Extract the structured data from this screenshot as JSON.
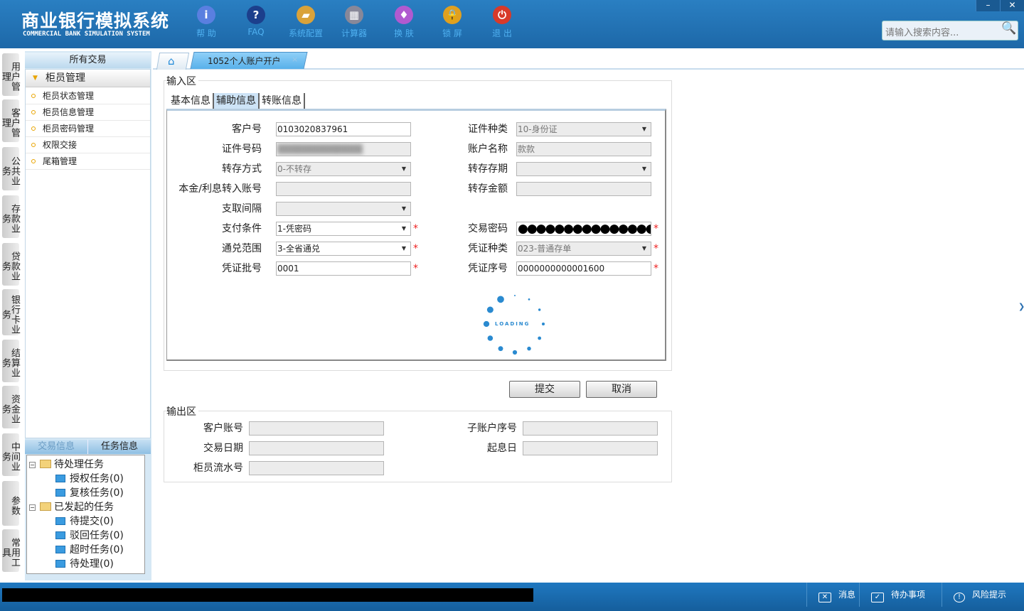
{
  "header": {
    "title_cn": "商业银行模拟系统",
    "title_en": "COMMERCIAL BANK SIMULATION SYSTEM",
    "tools": [
      {
        "label": "帮 助",
        "icon": "info-icon"
      },
      {
        "label": "FAQ",
        "icon": "question-icon"
      },
      {
        "label": "系统配置",
        "icon": "toolbox-icon"
      },
      {
        "label": "计算器",
        "icon": "calculator-icon"
      },
      {
        "label": "换 肤",
        "icon": "shirt-icon"
      },
      {
        "label": "锁 屏",
        "icon": "lock-icon"
      },
      {
        "label": "退 出",
        "icon": "power-icon"
      }
    ],
    "search_placeholder": "请输入搜索内容...",
    "minimize": "–",
    "close": "✕"
  },
  "vtabs": [
    "用户管理",
    "客户管理",
    "公共业务",
    "存款业务",
    "贷款业务",
    "银行卡业务",
    "结算业务",
    "资金业务",
    "中间业务",
    "参数",
    "常用工具"
  ],
  "menu": {
    "header": "所有交易",
    "group": "柜员管理",
    "items": [
      "柜员状态管理",
      "柜员信息管理",
      "柜员密码管理",
      "权限交接",
      "尾箱管理"
    ]
  },
  "tasks": {
    "tabs": [
      "交易信息",
      "任务信息"
    ],
    "active_tab": "任务信息",
    "tree": [
      {
        "label": "待处理任务",
        "children": [
          "授权任务(0)",
          "复核任务(0)"
        ]
      },
      {
        "label": "已发起的任务",
        "children": [
          "待提交(0)",
          "驳回任务(0)",
          "超时任务(0)",
          "待处理(0)"
        ]
      }
    ]
  },
  "tabs": {
    "home_icon": "home-icon",
    "page": "1052个人账户开户",
    "close": "×"
  },
  "input_area": {
    "legend": "输入区",
    "tabs": [
      "基本信息",
      "辅助信息",
      "转账信息"
    ],
    "active_tab": "辅助信息",
    "left": [
      {
        "label": "客户号",
        "value": "0103020837961",
        "type": "text"
      },
      {
        "label": "证件号码",
        "value": "",
        "type": "blurred"
      },
      {
        "label": "转存方式",
        "value": "0-不转存",
        "type": "select",
        "disabled": true
      },
      {
        "label": "本金/利息转入账号",
        "value": "",
        "type": "text",
        "disabled": true
      },
      {
        "label": "支取间隔",
        "value": "",
        "type": "select",
        "disabled": true
      },
      {
        "label": "支付条件",
        "value": "1-凭密码",
        "type": "select",
        "required": true
      },
      {
        "label": "通兑范围",
        "value": "3-全省通兑",
        "type": "select",
        "required": true
      },
      {
        "label": "凭证批号",
        "value": "0001",
        "type": "text",
        "required": true
      }
    ],
    "right": [
      {
        "label": "证件种类",
        "value": "10-身份证",
        "type": "select",
        "disabled": true
      },
      {
        "label": "账户名称",
        "value": "款款",
        "type": "text",
        "disabled": true
      },
      {
        "label": "转存存期",
        "value": "",
        "type": "select",
        "disabled": true
      },
      {
        "label": "转存金额",
        "value": "",
        "type": "text",
        "disabled": true
      },
      {
        "label": "交易密码",
        "value": "●●●●●●●●●●●●●●●",
        "type": "password",
        "required": true
      },
      {
        "label": "凭证种类",
        "value": "023-普通存单",
        "type": "select",
        "disabled": true,
        "required": true
      },
      {
        "label": "凭证序号",
        "value": "0000000000001600",
        "type": "text",
        "required": true
      }
    ],
    "required_mark": "*",
    "loading": "LOADING"
  },
  "buttons": {
    "submit": "提交",
    "cancel": "取消"
  },
  "output_area": {
    "legend": "输出区",
    "left": [
      "客户账号",
      "交易日期",
      "柜员流水号"
    ],
    "right": [
      "子账户序号",
      "起息日"
    ]
  },
  "statusbar": [
    {
      "label": "消息",
      "icon": "mail-icon"
    },
    {
      "label": "待办事项",
      "icon": "checkbox-icon"
    },
    {
      "label": "风险提示",
      "icon": "alert-bubble-icon"
    }
  ],
  "colors": {
    "header": "#1d68a8",
    "accent": "#2a8ad0",
    "required": "#e22222"
  }
}
